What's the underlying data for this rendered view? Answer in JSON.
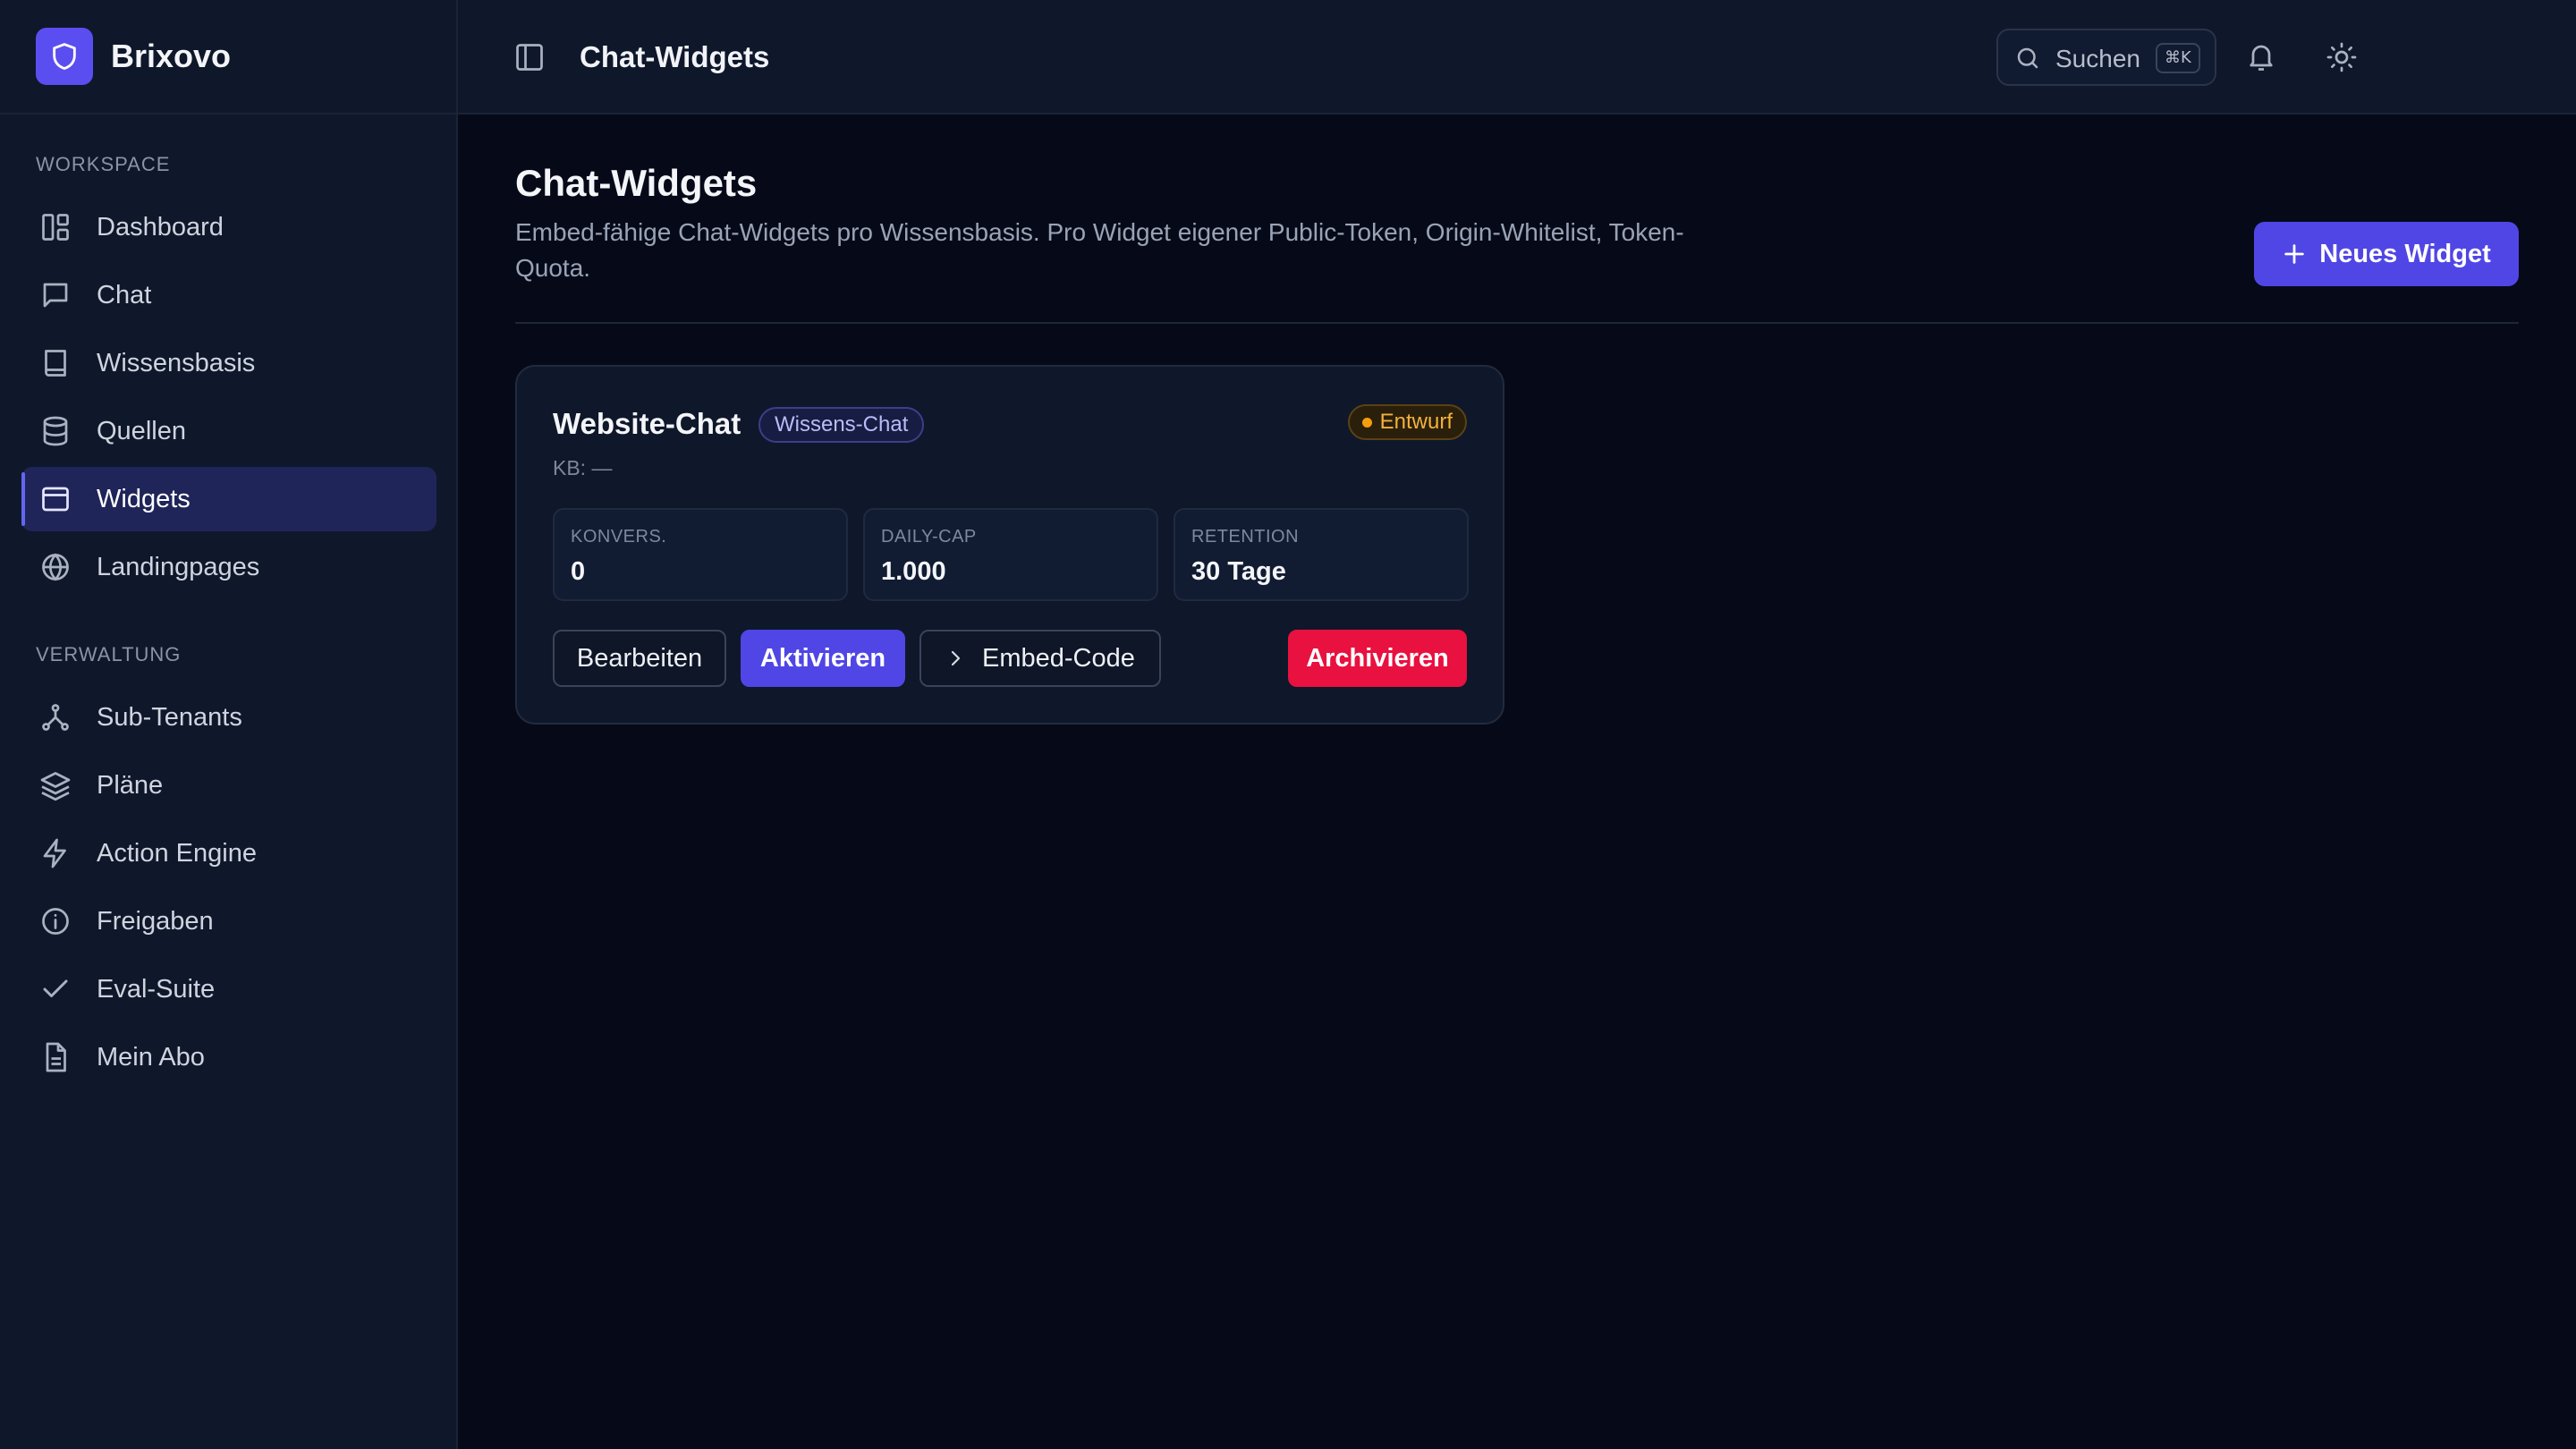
{
  "brand": {
    "name": "Brixovo"
  },
  "sidebar": {
    "sections": [
      {
        "label": "WORKSPACE",
        "items": [
          {
            "label": "Dashboard",
            "icon": "dashboard-icon"
          },
          {
            "label": "Chat",
            "icon": "chat-icon"
          },
          {
            "label": "Wissensbasis",
            "icon": "book-icon"
          },
          {
            "label": "Quellen",
            "icon": "database-icon"
          },
          {
            "label": "Widgets",
            "icon": "widget-icon",
            "active": true
          },
          {
            "label": "Landingpages",
            "icon": "globe-icon"
          }
        ]
      },
      {
        "label": "VERWALTUNG",
        "items": [
          {
            "label": "Sub-Tenants",
            "icon": "network-icon"
          },
          {
            "label": "Pläne",
            "icon": "layers-icon"
          },
          {
            "label": "Action Engine",
            "icon": "bolt-icon"
          },
          {
            "label": "Freigaben",
            "icon": "info-icon"
          },
          {
            "label": "Eval-Suite",
            "icon": "check-icon"
          },
          {
            "label": "Mein Abo",
            "icon": "document-icon"
          }
        ]
      }
    ]
  },
  "topbar": {
    "title": "Chat-Widgets",
    "search": {
      "label": "Suchen",
      "shortcut": "⌘K"
    }
  },
  "page": {
    "title": "Chat-Widgets",
    "description": "Embed-fähige Chat-Widgets pro Wissensbasis. Pro Widget eigener Public-Token, Origin-Whitelist, Token-Quota.",
    "new_button": "Neues Widget"
  },
  "widget": {
    "name": "Website-Chat",
    "type": "Wissens-Chat",
    "status": "Entwurf",
    "kb": "KB: —",
    "stats": [
      {
        "label": "KONVERS.",
        "value": "0"
      },
      {
        "label": "DAILY-CAP",
        "value": "1.000"
      },
      {
        "label": "RETENTION",
        "value": "30 Tage"
      }
    ],
    "actions": {
      "edit": "Bearbeiten",
      "activate": "Aktivieren",
      "embed": "Embed-Code",
      "archive": "Archivieren"
    }
  },
  "colors": {
    "accent": "#5046e5",
    "danger": "#e8113f",
    "warning": "#f59e0b",
    "background": "#060a18",
    "surface": "#0f172a"
  }
}
